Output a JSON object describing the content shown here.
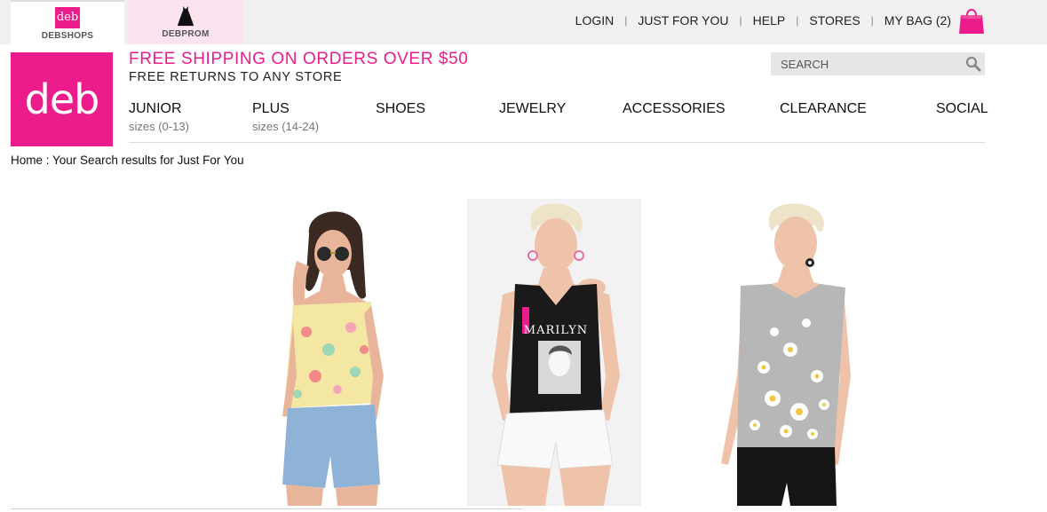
{
  "site_tabs": [
    {
      "label": "DEBSHOPS",
      "logo_text": "deb"
    },
    {
      "label": "DEBPROM"
    }
  ],
  "utility_nav": {
    "login": "LOGIN",
    "just_for_you": "JUST FOR YOU",
    "help": "HELP",
    "stores": "STORES",
    "bag": "MY BAG (2)",
    "separator": "|"
  },
  "brand": {
    "logo_text": "deb",
    "color": "#ec1c8c"
  },
  "promo": {
    "main": "FREE SHIPPING ON ORDERS OVER $50",
    "sub": "FREE RETURNS TO ANY STORE"
  },
  "search": {
    "placeholder": "SEARCH"
  },
  "main_nav": [
    {
      "label": "JUNIOR",
      "sub": "sizes (0-13)"
    },
    {
      "label": "PLUS",
      "sub": "sizes (14-24)"
    },
    {
      "label": "SHOES"
    },
    {
      "label": "JEWELRY"
    },
    {
      "label": "ACCESSORIES"
    },
    {
      "label": "CLEARANCE"
    },
    {
      "label": "SOCIAL"
    }
  ],
  "breadcrumb": {
    "home": "Home",
    "trail": " : Your Search results for Just For You"
  },
  "products": [
    {
      "image": "floral-tank-top-model"
    },
    {
      "image": "marilyn-graphic-tank-model",
      "shirt_text": "MARILYN"
    },
    {
      "image": "daisy-print-tank-model"
    }
  ]
}
